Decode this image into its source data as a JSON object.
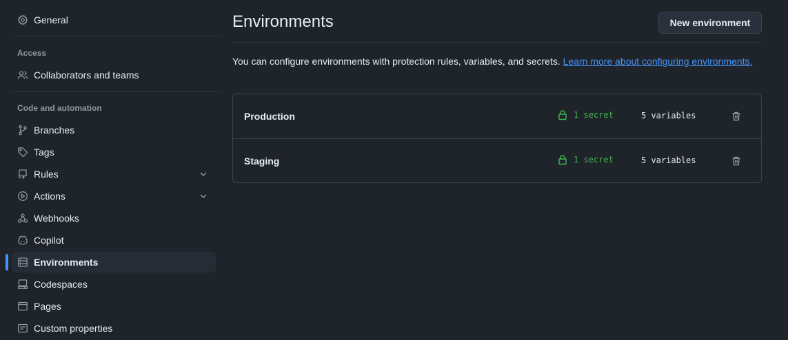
{
  "sidebar": {
    "general": {
      "label": "General",
      "icon": "gear-icon"
    },
    "sections": [
      {
        "heading": "Access",
        "items": [
          {
            "label": "Collaborators and teams",
            "icon": "people-icon"
          }
        ]
      },
      {
        "heading": "Code and automation",
        "items": [
          {
            "label": "Branches",
            "icon": "git-branch-icon"
          },
          {
            "label": "Tags",
            "icon": "tag-icon"
          },
          {
            "label": "Rules",
            "icon": "repo-push-icon",
            "expandable": true
          },
          {
            "label": "Actions",
            "icon": "play-icon",
            "expandable": true
          },
          {
            "label": "Webhooks",
            "icon": "webhook-icon"
          },
          {
            "label": "Copilot",
            "icon": "copilot-icon"
          },
          {
            "label": "Environments",
            "icon": "server-icon",
            "active": true
          },
          {
            "label": "Codespaces",
            "icon": "codespaces-icon"
          },
          {
            "label": "Pages",
            "icon": "browser-icon"
          },
          {
            "label": "Custom properties",
            "icon": "note-icon"
          }
        ]
      }
    ]
  },
  "main": {
    "title": "Environments",
    "new_button_label": "New environment",
    "description": "You can configure environments with protection rules, variables, and secrets.",
    "learn_more_link": "Learn more about configuring environments.",
    "environments": [
      {
        "name": "Production",
        "secrets": "1 secret",
        "variables": "5 variables"
      },
      {
        "name": "Staging",
        "secrets": "1 secret",
        "variables": "5 variables"
      }
    ]
  },
  "colors": {
    "background": "#1f232a",
    "accent": "#4493f8",
    "secret_green": "#3fb950",
    "border": "#3d444d"
  }
}
